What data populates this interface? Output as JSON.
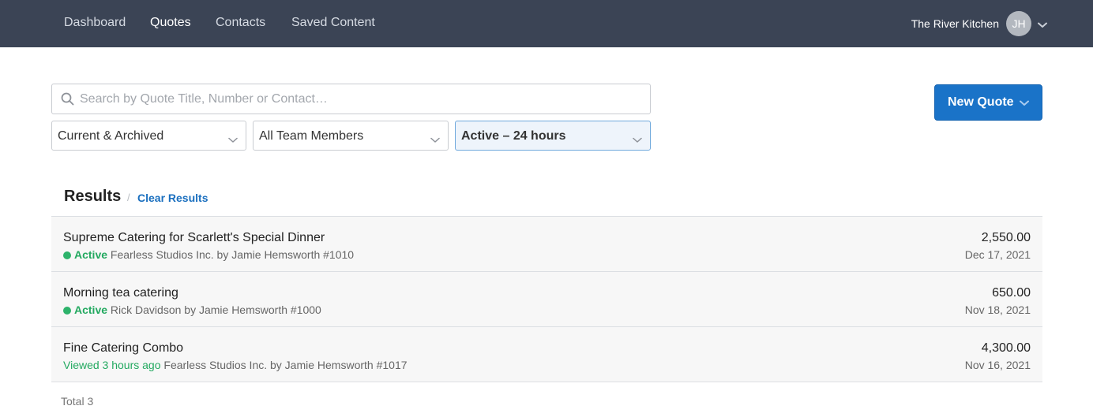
{
  "nav": {
    "items": [
      {
        "label": "Dashboard",
        "active": false
      },
      {
        "label": "Quotes",
        "active": true
      },
      {
        "label": "Contacts",
        "active": false
      },
      {
        "label": "Saved Content",
        "active": false
      }
    ],
    "account_name": "The River Kitchen",
    "avatar_initials": "JH"
  },
  "search": {
    "placeholder": "Search by Quote Title, Number or Contact…",
    "value": ""
  },
  "filters": {
    "status": "Current & Archived",
    "team": "All Team Members",
    "activity": "Active – 24 hours"
  },
  "new_quote_label": "New Quote",
  "results": {
    "title": "Results",
    "separator": "/",
    "clear_label": "Clear Results",
    "rows": [
      {
        "title": "Supreme Catering for Scarlett's Special Dinner",
        "status": "Active",
        "status_dot": true,
        "meta": "Fearless Studios Inc. by Jamie Hemsworth #1010",
        "amount": "2,550.00",
        "date": "Dec 17, 2021"
      },
      {
        "title": "Morning tea catering",
        "status": "Active",
        "status_dot": true,
        "meta": "Rick Davidson by Jamie Hemsworth #1000",
        "amount": "650.00",
        "date": "Nov 18, 2021"
      },
      {
        "title": "Fine Catering Combo",
        "status": "Viewed 3 hours ago",
        "status_dot": false,
        "meta": "Fearless Studios Inc. by Jamie Hemsworth #1017",
        "amount": "4,300.00",
        "date": "Nov 16, 2021"
      }
    ],
    "total_label": "Total 3"
  },
  "colors": {
    "nav_bg": "#3b4455",
    "primary": "#1a73c8",
    "active_green": "#23a960",
    "link_blue": "#1a6fbf"
  }
}
